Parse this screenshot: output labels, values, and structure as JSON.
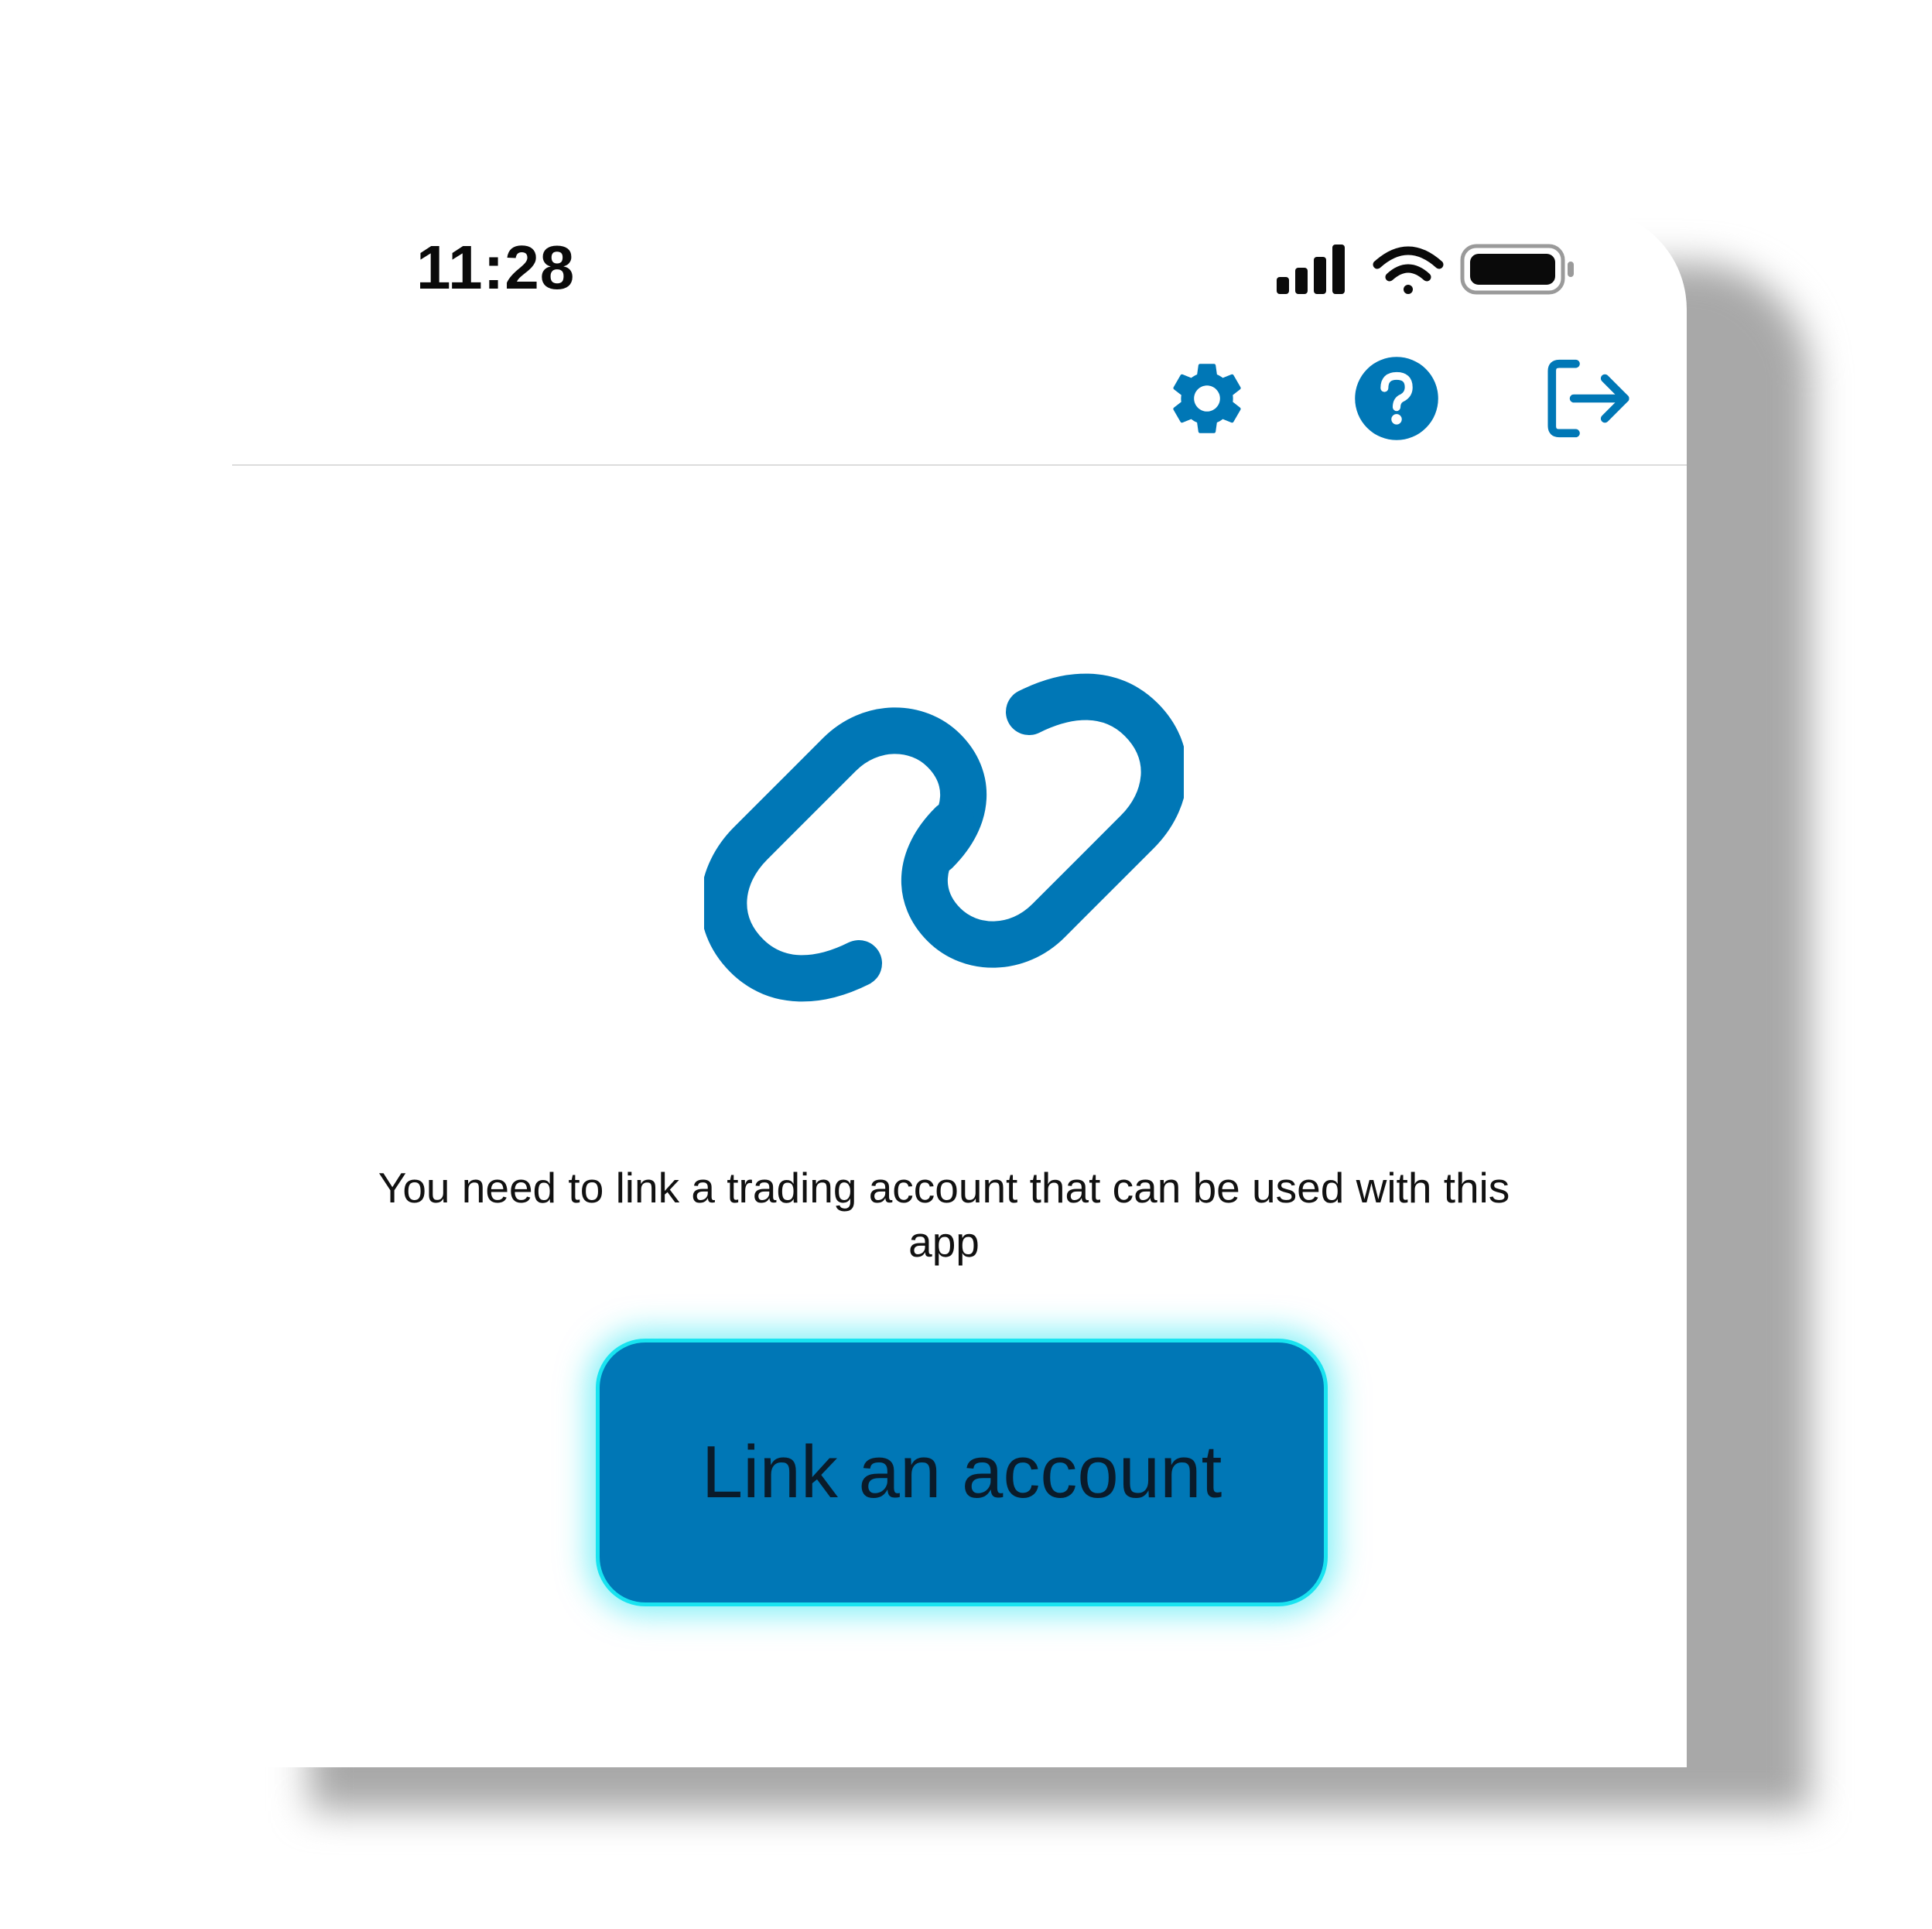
{
  "status_bar": {
    "time": "11:28",
    "icons": [
      "cellular-signal-icon",
      "wifi-icon",
      "battery-icon"
    ]
  },
  "toolbar": {
    "actions": [
      "settings-gear-icon",
      "help-question-icon",
      "logout-arrow-icon"
    ]
  },
  "content": {
    "icon": "link-chain-icon",
    "message": "You need to link a trading account that can be used with this app",
    "button_label": "Link an account"
  },
  "colors": {
    "accent": "#0077b6",
    "button_glow": "#19e3f0",
    "divider": "#dcdcdc",
    "text": "#111111"
  }
}
